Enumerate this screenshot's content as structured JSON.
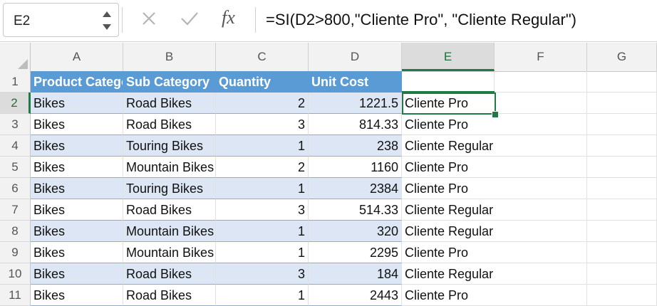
{
  "formula_bar": {
    "name_box": "E2",
    "fx_label": "fx",
    "formula": "=SI(D2>800,\"Cliente Pro\", \"Cliente Regular\")"
  },
  "columns": [
    "A",
    "B",
    "C",
    "D",
    "E",
    "F",
    "G"
  ],
  "header_row": {
    "row_number": "1",
    "cells": [
      "Product Category",
      "Sub Category",
      "Quantity",
      "Unit Cost",
      ""
    ]
  },
  "rows": [
    {
      "n": "2",
      "a": "Bikes",
      "b": "Road Bikes",
      "c": "2",
      "d": "1221.5",
      "e": "Cliente Pro"
    },
    {
      "n": "3",
      "a": "Bikes",
      "b": "Road Bikes",
      "c": "3",
      "d": "814.33",
      "e": "Cliente Pro"
    },
    {
      "n": "4",
      "a": "Bikes",
      "b": "Touring Bikes",
      "c": "1",
      "d": "238",
      "e": "Cliente Regular"
    },
    {
      "n": "5",
      "a": "Bikes",
      "b": "Mountain Bikes",
      "c": "2",
      "d": "1160",
      "e": "Cliente Pro"
    },
    {
      "n": "6",
      "a": "Bikes",
      "b": "Touring Bikes",
      "c": "1",
      "d": "2384",
      "e": "Cliente Pro"
    },
    {
      "n": "7",
      "a": "Bikes",
      "b": "Road Bikes",
      "c": "3",
      "d": "514.33",
      "e": "Cliente Regular"
    },
    {
      "n": "8",
      "a": "Bikes",
      "b": "Mountain Bikes",
      "c": "1",
      "d": "320",
      "e": "Cliente Regular"
    },
    {
      "n": "9",
      "a": "Bikes",
      "b": "Mountain Bikes",
      "c": "1",
      "d": "2295",
      "e": "Cliente Pro"
    },
    {
      "n": "10",
      "a": "Bikes",
      "b": "Road Bikes",
      "c": "3",
      "d": "184",
      "e": "Cliente Regular"
    },
    {
      "n": "11",
      "a": "Bikes",
      "b": "Road Bikes",
      "c": "1",
      "d": "2443",
      "e": "Cliente Pro"
    }
  ],
  "colors": {
    "table_header": "#5b9bd5",
    "band": "#dce6f4",
    "selection": "#1f7a45"
  }
}
